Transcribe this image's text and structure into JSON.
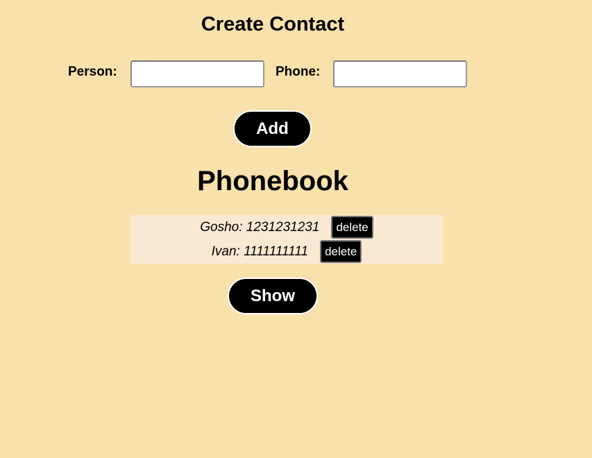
{
  "create_section": {
    "title": "Create Contact",
    "person_label": "Person:",
    "person_value": "",
    "phone_label": "Phone:",
    "phone_value": "",
    "add_label": "Add"
  },
  "phonebook": {
    "title": "Phonebook",
    "entries": [
      {
        "text": "Gosho: 1231231231",
        "delete_label": "delete"
      },
      {
        "text": "Ivan: 1111111111",
        "delete_label": "delete"
      }
    ],
    "show_label": "Show"
  },
  "colors": {
    "background": "#f8e1ab",
    "list_background": "#f9e9d3",
    "button_background": "#000000",
    "button_text": "#ffffff"
  }
}
